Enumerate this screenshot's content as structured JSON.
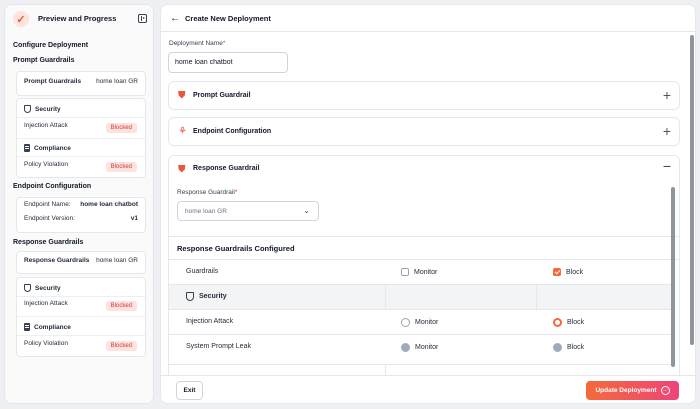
{
  "left_panel": {
    "title": "Preview and Progress",
    "configure_heading": "Configure Deployment",
    "prompt_guardrails": {
      "heading": "Prompt Guardrails",
      "name_label": "Prompt Guardrails",
      "name_value": "home loan GR",
      "security_title": "Security",
      "injection_label": "Injection Attack",
      "injection_status": "Blocked",
      "compliance_title": "Compliance",
      "policy_label": "Policy Violation",
      "policy_status": "Blocked"
    },
    "endpoint_config": {
      "heading": "Endpoint Configuration",
      "name_label": "Endpoint Name:",
      "name_value": "home loan chatbot",
      "version_label": "Endpoint Version:",
      "version_value": "v1"
    },
    "response_guardrails": {
      "heading": "Response Guardrails",
      "name_label": "Response Guardrails",
      "name_value": "home loan GR",
      "security_title": "Security",
      "injection_label": "Injection Attack",
      "injection_status": "Blocked",
      "compliance_title": "Compliance",
      "policy_label": "Policy Violation",
      "policy_status": "Blocked"
    }
  },
  "main": {
    "title": "Create New Deployment",
    "deployment_name_label": "Deployment Name",
    "deployment_name_value": "home loan chatbot",
    "sections": {
      "prompt_guardrail": "Prompt Guardrail",
      "endpoint_configuration": "Endpoint Configuration",
      "response_guardrail": "Response Guardrail"
    },
    "response_guardrail_label": "Response Guardrail",
    "response_guardrail_selected": "home loan GR",
    "table": {
      "title": "Response Guardrails Configured",
      "header": {
        "label": "Guardrails",
        "monitor": "Monitor",
        "block": "Block"
      },
      "group_security": "Security",
      "rows": [
        {
          "label": "Injection Attack",
          "monitor": "Monitor",
          "block": "Block"
        },
        {
          "label": "System Prompt Leak",
          "monitor": "Monitor",
          "block": "Block"
        }
      ]
    },
    "footer": {
      "exit": "Exit",
      "update": "Update Deployment"
    }
  },
  "colors": {
    "accent": "#f2683f",
    "badge_bg": "#fde2e0",
    "badge_text": "#d23b2f",
    "gradient_end": "#f0437a"
  }
}
